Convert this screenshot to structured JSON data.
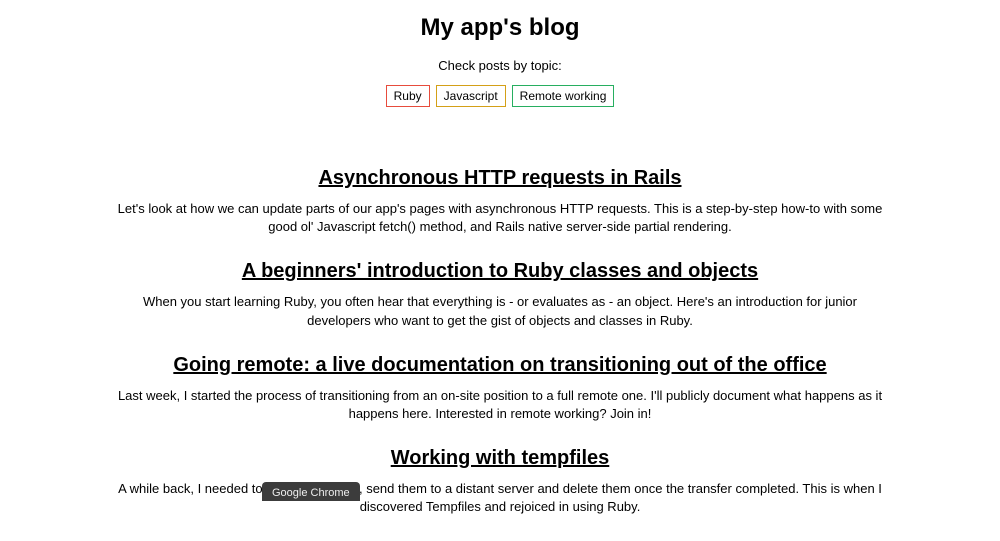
{
  "header": {
    "title": "My app's blog",
    "subtitle": "Check posts by topic:"
  },
  "tags": [
    {
      "label": "Ruby",
      "class": "tag-ruby"
    },
    {
      "label": "Javascript",
      "class": "tag-js"
    },
    {
      "label": "Remote working",
      "class": "tag-remote"
    }
  ],
  "posts": [
    {
      "title": "Asynchronous HTTP requests in Rails",
      "excerpt": "Let's look at how we can update parts of our app's pages with asynchronous HTTP requests. This is a step-by-step how-to with some good ol' Javascript fetch() method, and Rails native server-side partial rendering."
    },
    {
      "title": "A beginners' introduction to Ruby classes and objects",
      "excerpt": "When you start learning Ruby, you often hear that everything is - or evaluates as - an object. Here's an introduction for junior developers who want to get the gist of objects and classes in Ruby."
    },
    {
      "title": "Going remote: a live documentation on transitioning out of the office",
      "excerpt": "Last week, I started the process of transitioning from an on-site position to a full remote one. I'll publicly document what happens as it happens here. Interested in remote working? Join in!"
    },
    {
      "title": "Working with tempfiles",
      "excerpt": "A while back, I needed to create XML files, send them to a distant server and delete them once the transfer completed. This is when I discovered Tempfiles and rejoiced in using Ruby."
    }
  ],
  "dock": {
    "label": "Google Chrome"
  }
}
